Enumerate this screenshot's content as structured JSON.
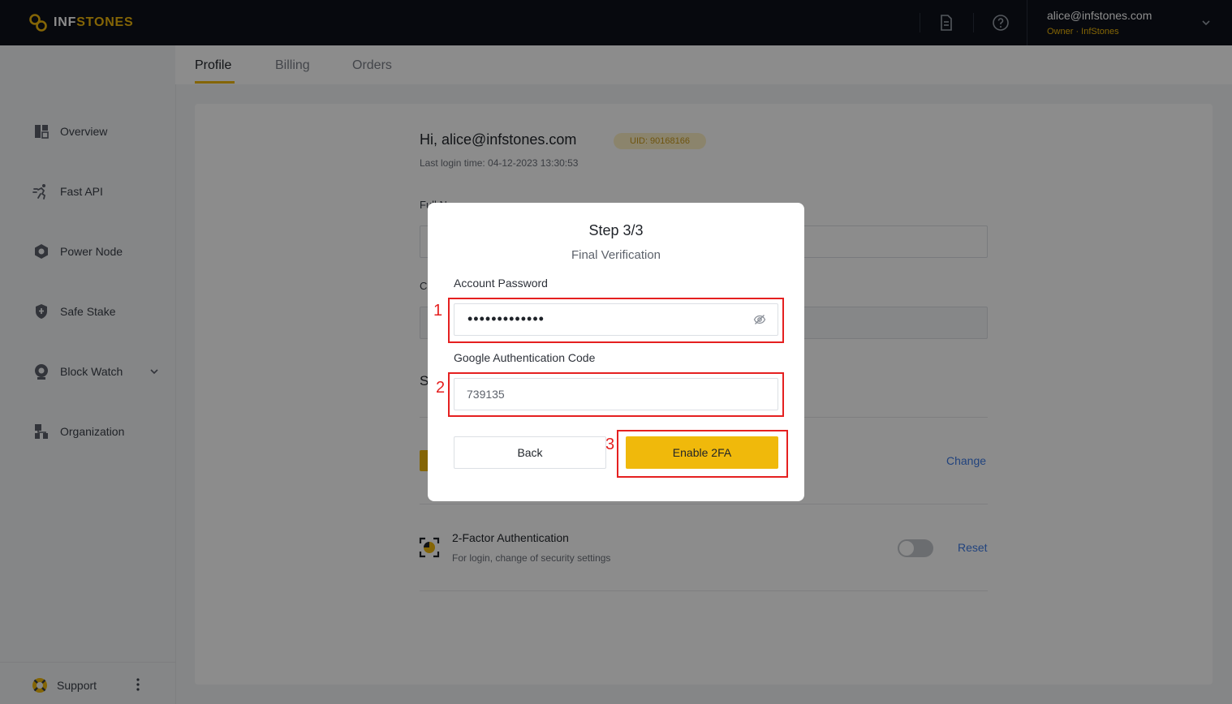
{
  "brand": {
    "logo_part1": "INF",
    "logo_part2": "STONES",
    "accent": "#f0b90b"
  },
  "topbar": {
    "icons": [
      "document-icon",
      "help-icon"
    ],
    "user_email": "alice@infstones.com",
    "user_role": "Owner · InfStones"
  },
  "sidebar": {
    "items": [
      {
        "label": "Overview",
        "icon": "overview-icon"
      },
      {
        "label": "Fast API",
        "icon": "fast-api-icon"
      },
      {
        "label": "Power Node",
        "icon": "power-node-icon"
      },
      {
        "label": "Safe Stake",
        "icon": "safe-stake-icon"
      },
      {
        "label": "Block Watch",
        "icon": "block-watch-icon"
      },
      {
        "label": "Organization",
        "icon": "organization-icon"
      }
    ],
    "support_label": "Support"
  },
  "tabs": [
    {
      "label": "Profile",
      "active": true
    },
    {
      "label": "Billing",
      "active": false
    },
    {
      "label": "Orders",
      "active": false
    }
  ],
  "profile": {
    "greeting": "Hi, alice@infstones.com",
    "uid": "UID: 90168166",
    "last_login": "Last login time: 04-12-2023 13:30:53",
    "full_name_label_partial": "Full N",
    "second_label_partial": "C",
    "section_heading_partial": "S",
    "change_link": "Change",
    "tfa_title": "2-Factor Authentication",
    "tfa_desc": "For login, change of security settings",
    "tfa_enabled": false,
    "reset_link": "Reset"
  },
  "modal": {
    "title": "Step 3/3",
    "subtitle": "Final Verification",
    "password_label": "Account Password",
    "password_value": "•••••••••••••",
    "code_label": "Google Authentication Code",
    "code_value": "739135",
    "back_label": "Back",
    "enable_label": "Enable 2FA"
  },
  "annotations": [
    "1",
    "2",
    "3"
  ]
}
